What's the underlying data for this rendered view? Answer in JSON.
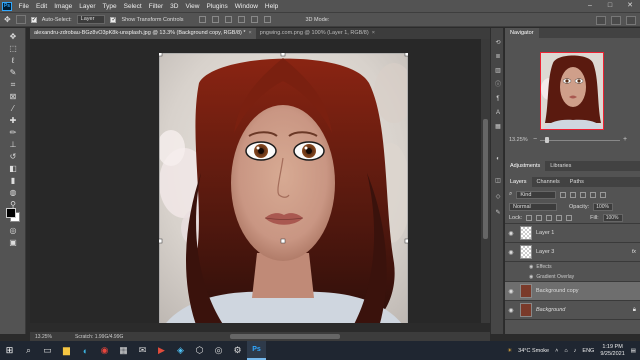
{
  "app": {
    "logo": "Ps"
  },
  "menu": [
    "File",
    "Edit",
    "Image",
    "Layer",
    "Type",
    "Select",
    "Filter",
    "3D",
    "View",
    "Plugins",
    "Window",
    "Help"
  ],
  "options": {
    "auto_select_label": "Auto-Select:",
    "auto_select_value": "Layer",
    "transform_label": "Show Transform Controls",
    "mode_3d_label": "3D Mode:"
  },
  "tabs": [
    {
      "label": "alexandru-zdrobau-BGz8vO3pK8k-unsplash.jpg @ 13.3% (Background copy, RGB/8) *",
      "close": "×"
    },
    {
      "label": "pngwing.com.png @ 100% (Layer 1, RGB/8)",
      "close": "×"
    }
  ],
  "status": {
    "zoom": "13.25%",
    "doc": "Scratch: 1.99G/4.99G"
  },
  "navigator": {
    "title": "Navigator",
    "zoom": "13.25%",
    "minus": "−",
    "plus": "+"
  },
  "adjustments": {
    "tabs": [
      "Adjustments",
      "Libraries"
    ]
  },
  "layers_panel": {
    "tabs": [
      "Layers",
      "Channels",
      "Paths"
    ],
    "kind": "Kind",
    "blend_mode": "Normal",
    "opacity_label": "Opacity:",
    "opacity_value": "100%",
    "lock_label": "Lock:",
    "fill_label": "Fill:",
    "fill_value": "100%",
    "layers": [
      {
        "name": "Layer 1"
      },
      {
        "name": "Layer 3",
        "fx": "fx"
      },
      {
        "name": "Background copy"
      },
      {
        "name": "Background"
      }
    ],
    "effects_label": "Effects",
    "gradient_label": "Gradient Overlay"
  },
  "taskbar": {
    "weather": "34°C  Smoke",
    "lang": "ENG",
    "time": "1:19 PM",
    "date": "9/25/2021"
  },
  "colors": {
    "accent": "#31a8ff",
    "chrome": "#535353",
    "taskbar": "#1f2631"
  }
}
